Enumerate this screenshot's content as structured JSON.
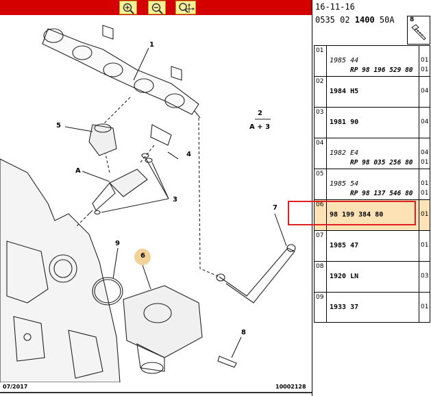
{
  "toolbar": {
    "buttons": [
      {
        "name": "zoom-in",
        "icon": "magnifier-plus-icon"
      },
      {
        "name": "zoom-out",
        "icon": "magnifier-minus-icon"
      },
      {
        "name": "zoom-pan",
        "icon": "magnifier-move-icon"
      }
    ],
    "bar_color": "#d40000",
    "button_color": "#f7ef9a"
  },
  "diagram": {
    "callouts": {
      "c1": "1",
      "c2": "2",
      "c2b": "A + 3",
      "c3": "3",
      "c4": "4",
      "c5": "5",
      "cA": "A",
      "c6": "6",
      "c7": "7",
      "c8": "8",
      "c9": "9"
    },
    "footer_left": "07/2017",
    "footer_right": "10002128"
  },
  "header": {
    "date": "16-11-16",
    "code_prefix": "0535 02 ",
    "code_bold": "1400",
    "code_suffix": " 50A",
    "screw_label": "8"
  },
  "table": {
    "rows": [
      {
        "idx": "01",
        "ref": "1985 44",
        "ref2": "RP 98 196 529 80",
        "qty1": "01",
        "qty2": "01",
        "italic": true,
        "selected": false
      },
      {
        "idx": "02",
        "ref": "1984 H5",
        "ref2": "",
        "qty1": "04",
        "qty2": "",
        "italic": false,
        "selected": false
      },
      {
        "idx": "03",
        "ref": "1981 90",
        "ref2": "",
        "qty1": "04",
        "qty2": "",
        "italic": false,
        "selected": false
      },
      {
        "idx": "04",
        "ref": "1982 E4",
        "ref2": "RP 98 035 256 80",
        "qty1": "04",
        "qty2": "01",
        "italic": true,
        "selected": false
      },
      {
        "idx": "05",
        "ref": "1985 54",
        "ref2": "RP 98 137 546 80",
        "qty1": "01",
        "qty2": "01",
        "italic": true,
        "selected": false
      },
      {
        "idx": "06",
        "ref": "98 199 384 80",
        "ref2": "",
        "qty1": "01",
        "qty2": "",
        "italic": false,
        "selected": true
      },
      {
        "idx": "07",
        "ref": "1985 47",
        "ref2": "",
        "qty1": "01",
        "qty2": "",
        "italic": false,
        "selected": false
      },
      {
        "idx": "08",
        "ref": "1920 LN",
        "ref2": "",
        "qty1": "03",
        "qty2": "",
        "italic": false,
        "selected": false
      },
      {
        "idx": "09",
        "ref": "1933 37",
        "ref2": "",
        "qty1": "01",
        "qty2": "",
        "italic": false,
        "selected": false
      }
    ],
    "highlight_color": "#e02020",
    "selected_fill": "#fde2b5"
  }
}
